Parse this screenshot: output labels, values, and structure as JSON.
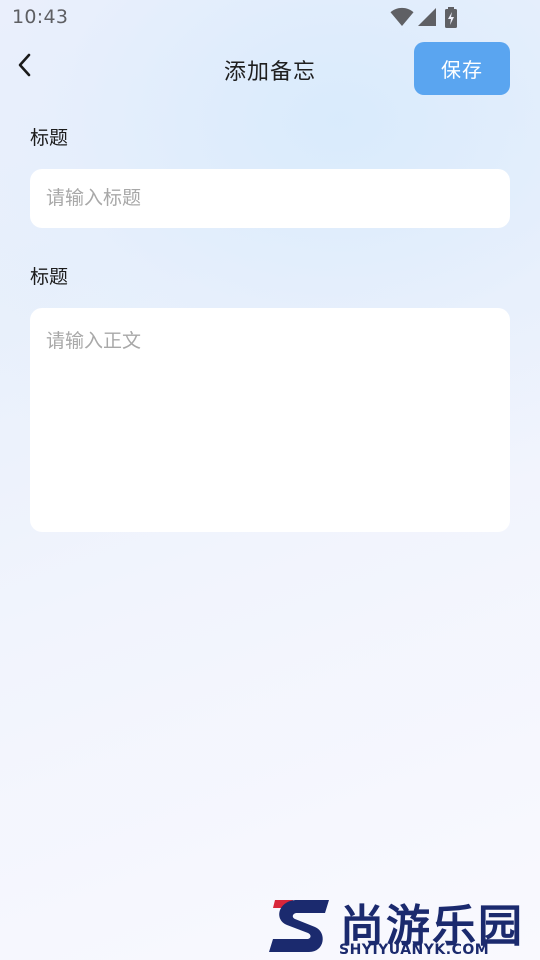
{
  "status_bar": {
    "time": "10:43"
  },
  "header": {
    "title": "添加备忘",
    "save_label": "保存",
    "back_icon": "chevron-left-icon"
  },
  "form": {
    "title_label": "标题",
    "title_placeholder": "请输入标题",
    "title_value": "",
    "body_label": "标题",
    "body_placeholder": "请输入正文",
    "body_value": ""
  },
  "watermark": {
    "text": "尚游乐园",
    "url": "SHYIYUANYK.COM"
  },
  "colors": {
    "accent": "#5aa5f0",
    "watermark": "#1b2a6e"
  }
}
